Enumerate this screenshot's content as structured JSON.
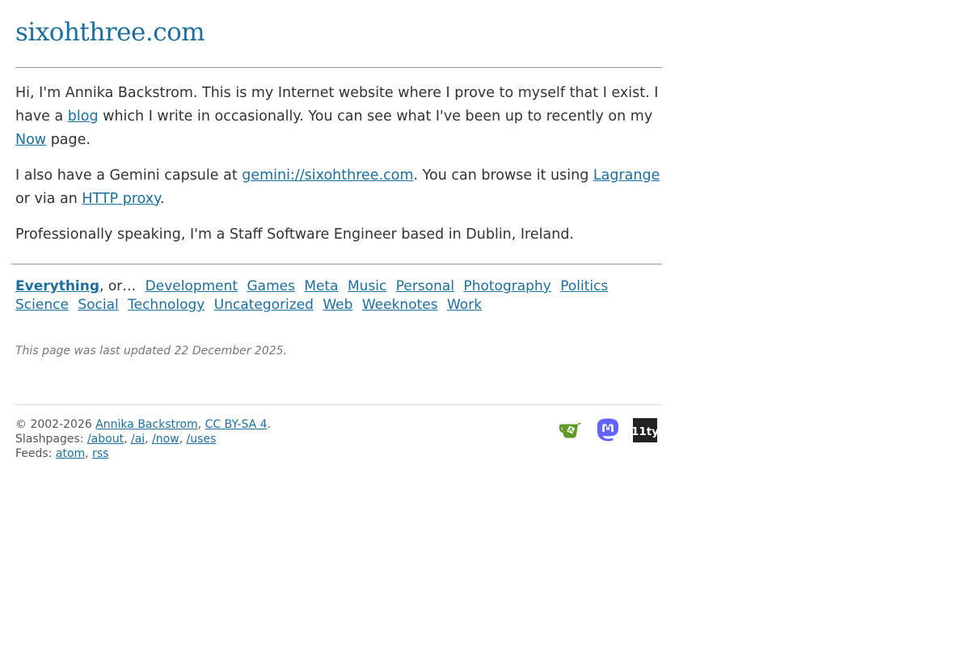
{
  "site": {
    "title": "sixohthree.com"
  },
  "intro": {
    "p1_a": "Hi, I'm Annika Backstrom. This is my Internet website where I prove to myself that I exist. I have a ",
    "p1_link_blog": "blog",
    "p1_b": " which I write in occasionally. You can see what I've been up to recently on my ",
    "p1_link_now": "Now",
    "p1_c": " page.",
    "p2_a": "I also have a Gemini capsule at ",
    "p2_link_gemini": "gemini://sixohthree.com",
    "p2_b": ". You can browse it using ",
    "p2_link_lagrange": "Lagrange",
    "p2_c": " or via an ",
    "p2_link_proxy": "HTTP proxy",
    "p2_d": ".",
    "p3": "Professionally speaking, I'm a Staff Software Engineer based in Dublin, Ireland."
  },
  "categories": {
    "everything": "Everything",
    "or_text": ", or…",
    "items": [
      "Development",
      "Games",
      "Meta",
      "Music",
      "Personal",
      "Photography",
      "Politics",
      "Science",
      "Social",
      "Technology",
      "Uncategorized",
      "Web",
      "Weeknotes",
      "Work"
    ]
  },
  "updated": {
    "text": "This page was last updated 22 December 2025."
  },
  "footer": {
    "copyright_prefix": "© 2002-2026 ",
    "author_link": "Annika Backstrom",
    "sep1": ", ",
    "license_link": "CC BY-SA 4",
    "copyright_end": ".",
    "slash_label": "Slashpages: ",
    "slash_links": [
      "/about",
      "/ai",
      "/now",
      "/uses"
    ],
    "feeds_label": "Feeds: ",
    "feed_links": [
      "atom",
      "rss"
    ],
    "comma": ", "
  },
  "icons": {
    "gitea": "gitea-icon",
    "mastodon": "mastodon-icon",
    "eleventy": "eleventy-icon",
    "eleventy_text": "11ty"
  },
  "colors": {
    "link": "#1d6f9d",
    "gitea_green": "#609926",
    "mastodon_purple": "#6364ff",
    "eleventy_black": "#222222"
  }
}
